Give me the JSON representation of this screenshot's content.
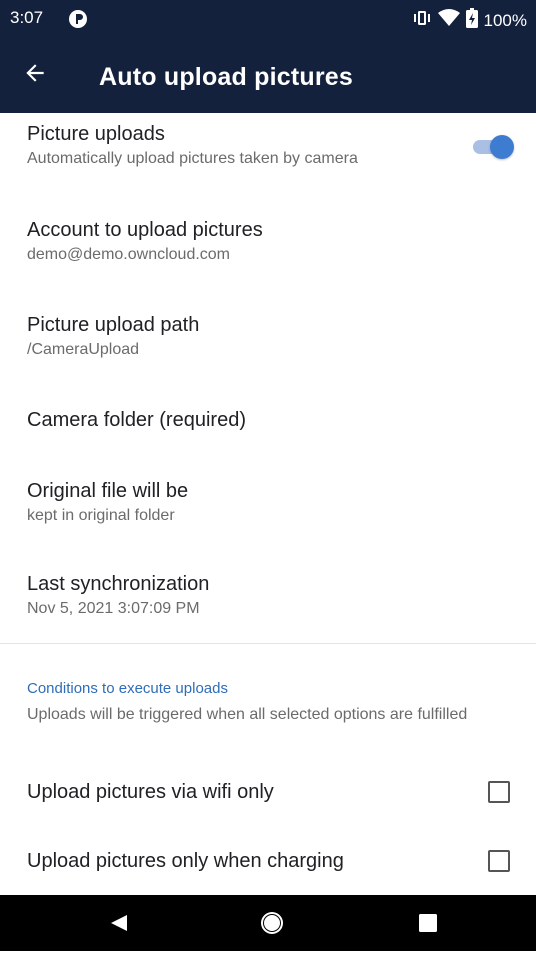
{
  "status_bar": {
    "time": "3:07",
    "battery": "100%",
    "icons": [
      "app-notification-icon",
      "vibrate-icon",
      "wifi-icon",
      "battery-icon"
    ]
  },
  "app_bar": {
    "title": "Auto upload pictures",
    "background": "#14213d"
  },
  "preferences": {
    "picture_uploads": {
      "title": "Picture uploads",
      "summary": "Automatically upload pictures taken by camera",
      "enabled": true
    },
    "account": {
      "title": "Account to upload pictures",
      "summary": "demo@demo.owncloud.com"
    },
    "upload_path": {
      "title": "Picture upload path",
      "summary": "/CameraUpload"
    },
    "camera_folder": {
      "title": "Camera folder (required)"
    },
    "original_file": {
      "title": "Original file will be",
      "summary": "kept in original folder"
    },
    "last_sync": {
      "title": "Last synchronization",
      "summary": "Nov 5, 2021 3:07:09 PM"
    }
  },
  "conditions": {
    "title": "Conditions to execute uploads",
    "summary": "Uploads will be triggered when all selected options are fulfilled",
    "accent": "#2f6db8",
    "wifi_only": {
      "label": "Upload pictures via wifi only",
      "checked": false
    },
    "charging_only": {
      "label": "Upload pictures only when charging",
      "checked": false
    }
  },
  "nav_bar": {
    "icons": [
      "back-triangle-icon",
      "home-circle-icon",
      "recents-square-icon"
    ]
  }
}
